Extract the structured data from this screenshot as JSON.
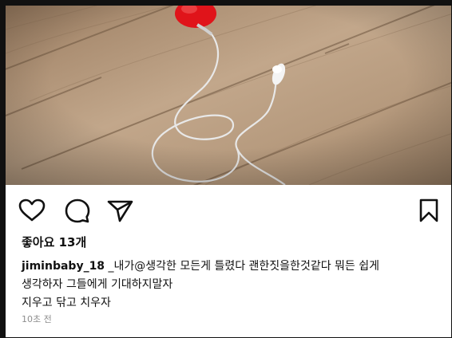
{
  "post": {
    "likes_text": "좋아요 13개",
    "username": "jiminbaby_18",
    "caption_lines": [
      " _내가@생각한 모든게 틀렸다  괜한짓을한것같다 뭐든 쉽게",
      "생각하자 그들에게 기대하지말자",
      "지우고 닦고 치우자"
    ],
    "timestamp": "10초 전"
  },
  "actions": {
    "like_icon": "heart-outline-icon",
    "comment_icon": "speech-bubble-icon",
    "share_icon": "paper-plane-icon",
    "save_icon": "bookmark-icon"
  },
  "colors": {
    "text": "#111111",
    "muted": "#8e8e8e",
    "floor": "#b89d80"
  }
}
